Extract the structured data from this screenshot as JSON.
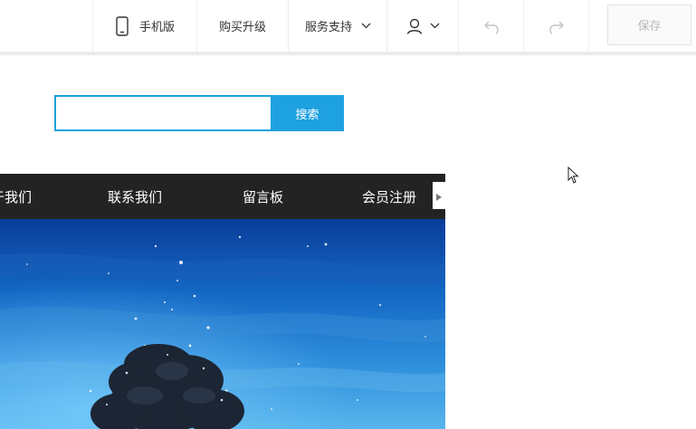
{
  "toolbar": {
    "mobile_label": "手机版",
    "buy_label": "购买升级",
    "support_label": "服务支持",
    "save_label": "保存",
    "icons": {
      "mobile": "mobile-phone-icon",
      "support_dropdown": "chevron-down-icon",
      "user": "user-icon",
      "user_dropdown": "chevron-down-icon",
      "undo": "undo-icon",
      "redo": "redo-icon"
    }
  },
  "search": {
    "value": "",
    "placeholder": "",
    "button_label": "搜索"
  },
  "nav": {
    "items": [
      {
        "label": "于我们"
      },
      {
        "label": "联系我们"
      },
      {
        "label": "留言板"
      },
      {
        "label": "会员注册"
      }
    ],
    "next_icon": "triangle-right-icon"
  },
  "banner": {
    "image": "starry-night-tree-banner"
  },
  "colors": {
    "accent": "#1ea1e0",
    "nav_bg": "#232323",
    "save_text_disabled": "#b9b9b9"
  }
}
